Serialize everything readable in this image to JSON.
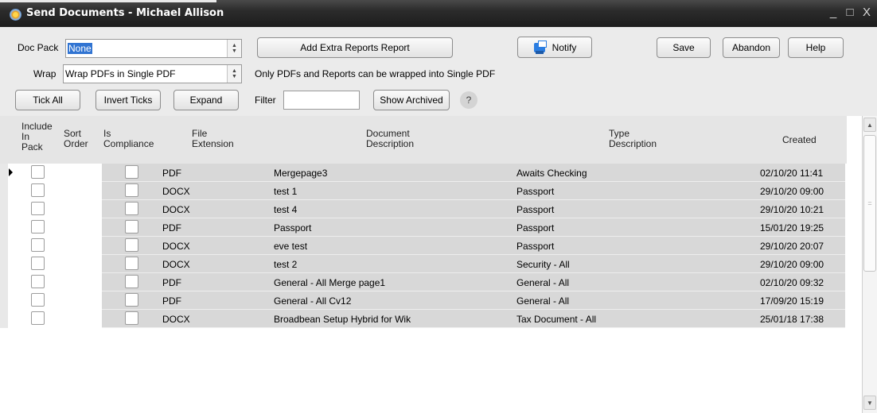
{
  "window": {
    "title": "Send Documents -  Michael Allison",
    "controls": [
      "_",
      "□",
      "X"
    ]
  },
  "toolbar": {
    "doc_pack_label": "Doc Pack",
    "doc_pack_value": "None",
    "wrap_label": "Wrap",
    "wrap_value": "Wrap PDFs in Single PDF",
    "wrap_note": "Only PDFs and Reports can be  wrapped into Single PDF",
    "add_extra_reports": "Add Extra Reports Report",
    "notify": "Notify",
    "save": "Save",
    "abandon": "Abandon",
    "help": "Help",
    "tick_all": "Tick All",
    "invert_ticks": "Invert Ticks",
    "expand": "Expand",
    "filter_label": "Filter",
    "filter_value": "",
    "show_archived": "Show Archived",
    "question": "?"
  },
  "grid": {
    "headers": {
      "include": "Include\nIn\nPack",
      "sort": "Sort\nOrder",
      "compliance": "Is\nCompliance",
      "extension": "File\nExtension",
      "description": "Document\nDescription",
      "type": "Type\nDescription",
      "created": "Created"
    },
    "rows": [
      {
        "ext": "PDF",
        "desc": "Mergepage3",
        "type": "Awaits Checking",
        "created": "02/10/20 11:41"
      },
      {
        "ext": "DOCX",
        "desc": "test 1",
        "type": "Passport",
        "created": "29/10/20 09:00"
      },
      {
        "ext": "DOCX",
        "desc": "test 4",
        "type": "Passport",
        "created": "29/10/20 10:21"
      },
      {
        "ext": "PDF",
        "desc": "Passport",
        "type": "Passport",
        "created": "15/01/20 19:25"
      },
      {
        "ext": "DOCX",
        "desc": "eve test",
        "type": "Passport",
        "created": "29/10/20 20:07"
      },
      {
        "ext": "DOCX",
        "desc": "test 2",
        "type": "Security - All",
        "created": "29/10/20 09:00"
      },
      {
        "ext": "PDF",
        "desc": "General - All Merge page1",
        "type": "General - All",
        "created": "02/10/20 09:32"
      },
      {
        "ext": "PDF",
        "desc": "General - All Cv12",
        "type": "General - All",
        "created": "17/09/20 15:19"
      },
      {
        "ext": "DOCX",
        "desc": "Broadbean Setup Hybrid for Wik",
        "type": "Tax Document - All",
        "created": "25/01/18 17:38"
      }
    ]
  },
  "icons": {
    "app": "app-gear-icon",
    "notify": "notify-computer-icon",
    "current_row": "row-pointer-icon",
    "scroll_up": "chevron-up-icon",
    "scroll_down": "chevron-down-icon"
  }
}
